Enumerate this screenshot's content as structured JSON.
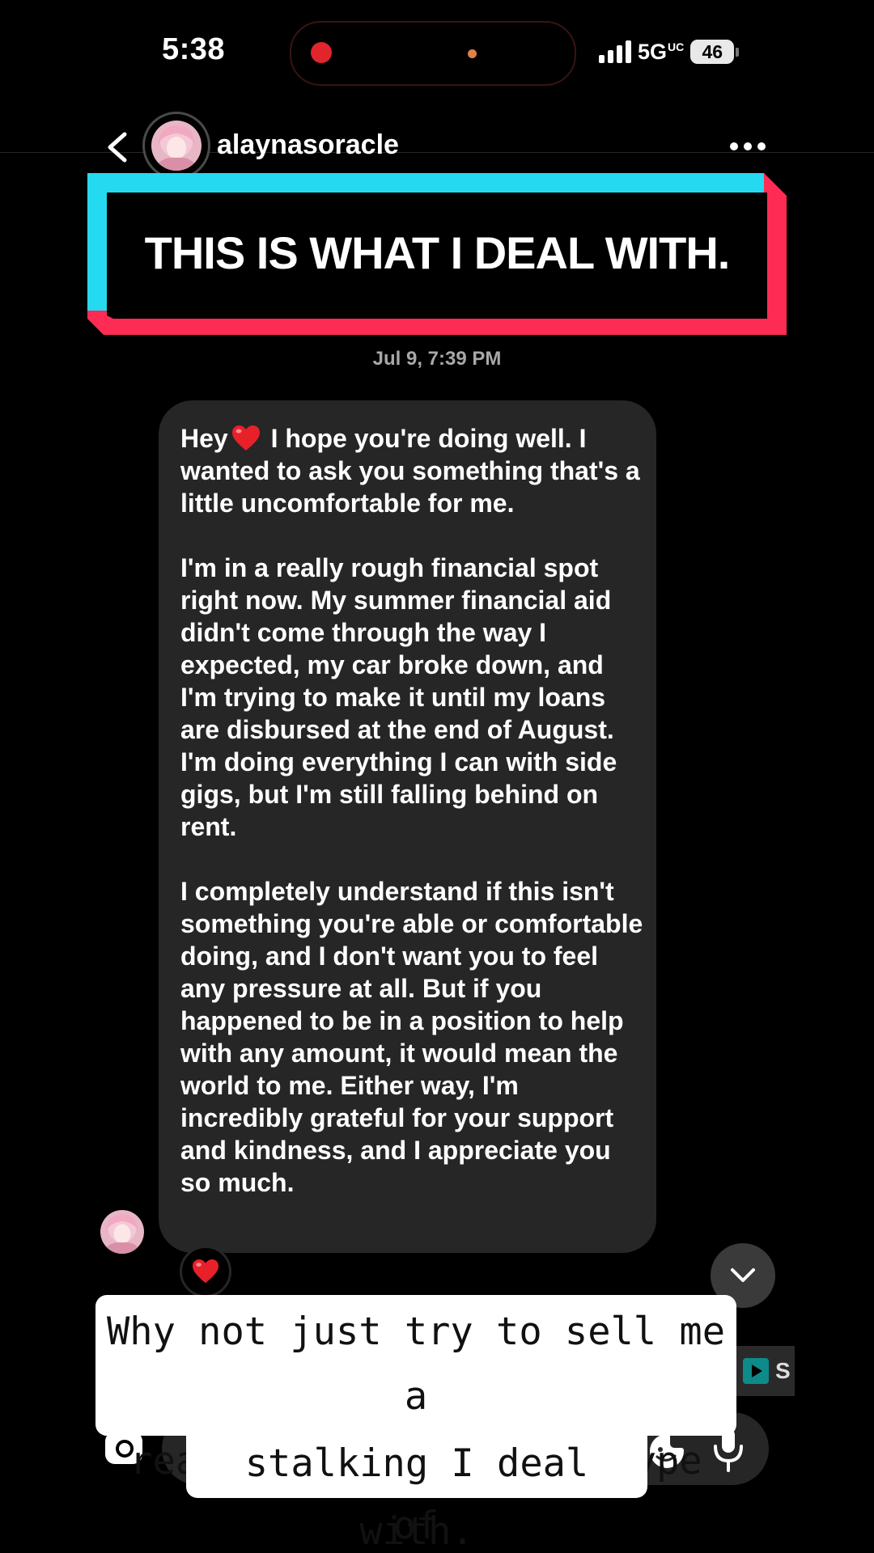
{
  "status_bar": {
    "time": "5:38",
    "network": "5G",
    "network_suffix": "UC",
    "battery": "46"
  },
  "header": {
    "username": "alaynasoracle"
  },
  "banner": {
    "text": "THIS IS WHAT I DEAL WITH.",
    "colors": {
      "cyan": "#25d9f0",
      "red": "#fe2c55"
    }
  },
  "chat": {
    "timestamp": "Jul 9, 7:39 PM",
    "message": {
      "greeting": "Hey",
      "emoji": "heart",
      "body": " I hope you're doing well. I wanted to ask you something that's a little uncomfortable for me.\n\nI'm in a really rough financial spot right now. My summer financial aid didn't come through the way I expected, my car broke down, and I'm trying to make it until my loans are disbursed at the end of August. I'm doing everything I can with side gigs, but I'm still falling behind on rent.\n\nI completely understand if this isn't something you're able or comfortable doing, and I don't want you to feel any pressure at all. But if you happened to be in a position to help with any amount, it would mean the world to me. Either way, I'm incredibly grateful for your support and kindness, and I appreciate you so much."
    },
    "reaction": "heart"
  },
  "side_chip": {
    "label": "S"
  },
  "caption": {
    "line1": "Why not just try to sell me a",
    "line2": "reading? This is the type of",
    "line3": "stalking I deal with."
  }
}
